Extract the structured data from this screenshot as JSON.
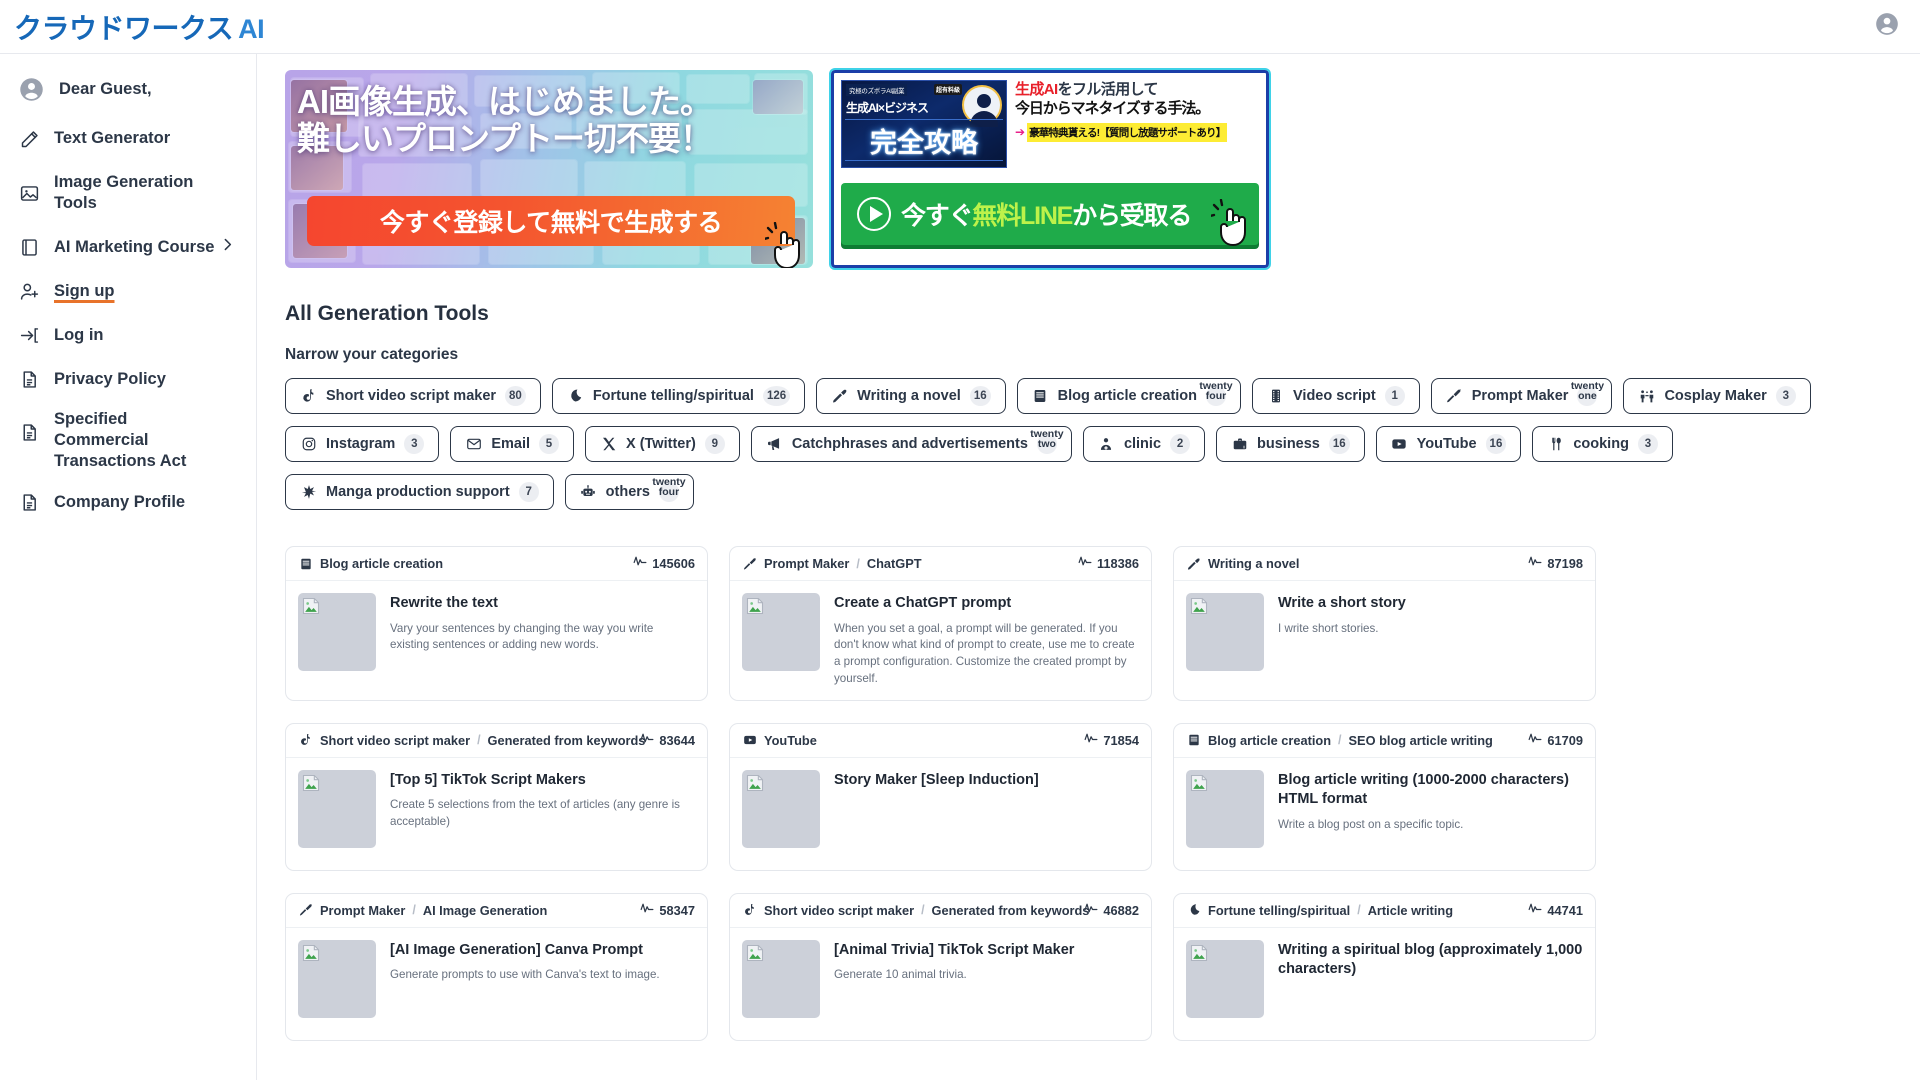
{
  "header": {
    "brand_jp": "クラウドワークス",
    "brand_ai": "AI",
    "account_icon": "account-circle-icon"
  },
  "sidebar": {
    "items": [
      {
        "label": "Dear Guest,",
        "icon": "account-circle-icon",
        "kind": "guest"
      },
      {
        "label": "Text Generator",
        "icon": "pencil-icon",
        "kind": "link"
      },
      {
        "label": "Image Generation Tools",
        "icon": "image-icon",
        "kind": "link"
      },
      {
        "label": "AI Marketing Course",
        "icon": "book-icon",
        "kind": "link",
        "chevron": "chevron-right-icon"
      },
      {
        "label": "Sign up",
        "icon": "user-plus-icon",
        "kind": "signup"
      },
      {
        "label": "Log in",
        "icon": "login-arrow-icon",
        "kind": "link"
      },
      {
        "label": "Privacy Policy",
        "icon": "document-icon",
        "kind": "link"
      },
      {
        "label": "Specified Commercial Transactions Act",
        "icon": "document-icon",
        "kind": "wrap"
      },
      {
        "label": "Company Profile",
        "icon": "document-icon",
        "kind": "link"
      }
    ]
  },
  "banners": [
    {
      "name": "ai-image-generation-banner",
      "line1": "AI画像生成、はじめました。",
      "line2": "難しいプロンプトー切不要！",
      "cta": "今すぐ登録して無料で生成する",
      "cta_color": "#f4542f"
    },
    {
      "name": "ai-marketing-line-banner",
      "thumb_tag": "究極のズボラAI副業",
      "thumb_badge": "超有料級",
      "thumb_line1": "生成AI×ビジネス",
      "thumb_line2": "完全攻略",
      "copy_red": "生成AI",
      "copy_line1_rest": "をフル活用して",
      "copy_line2": "今日からマネタイズする手法。",
      "highlight": "豪華特典貰える!【質問し放題サポートあり】",
      "cta_pre": "今すぐ",
      "cta_lime": "無料LINE",
      "cta_post": "から受取る",
      "cta_color": "#1fab4a",
      "highlight_color": "#fdec34"
    }
  ],
  "main": {
    "title": "All Generation Tools",
    "subtitle": "Narrow your categories"
  },
  "categories": [
    {
      "label": "Short video script maker",
      "count": "80",
      "icon": "tiktok-icon"
    },
    {
      "label": "Fortune telling/spiritual",
      "count": "126",
      "icon": "moon-icon"
    },
    {
      "label": "Writing a novel",
      "count": "16",
      "icon": "fountain-pen-icon"
    },
    {
      "label": "Blog article creation",
      "count": "twenty four",
      "icon": "book-icon",
      "count_word": true
    },
    {
      "label": "Video script",
      "count": "1",
      "icon": "film-strip-icon"
    },
    {
      "label": "Prompt Maker",
      "count": "twenty one",
      "icon": "brush-icon",
      "count_word": true
    },
    {
      "label": "Cosplay Maker",
      "count": "3",
      "icon": "cosplay-icon"
    },
    {
      "label": "Instagram",
      "count": "3",
      "icon": "instagram-icon"
    },
    {
      "label": "Email",
      "count": "5",
      "icon": "envelope-icon"
    },
    {
      "label": "X (Twitter)",
      "count": "9",
      "icon": "x-twitter-icon"
    },
    {
      "label": "Catchphrases and advertisements",
      "count": "twenty two",
      "icon": "megaphone-icon",
      "count_word": true
    },
    {
      "label": "clinic",
      "count": "2",
      "icon": "doctor-icon"
    },
    {
      "label": "business",
      "count": "16",
      "icon": "briefcase-icon"
    },
    {
      "label": "YouTube",
      "count": "16",
      "icon": "youtube-icon"
    },
    {
      "label": "cooking",
      "count": "3",
      "icon": "cutlery-icon"
    },
    {
      "label": "Manga production support",
      "count": "7",
      "icon": "sparkle-icon"
    },
    {
      "label": "others",
      "count": "twenty four",
      "icon": "robot-icon",
      "count_word": true
    }
  ],
  "cards": [
    {
      "category": "Blog article creation",
      "subcategory": "",
      "icon": "book-icon",
      "stat": "145606",
      "stat_icon": "activity-pulse-icon",
      "title": "Rewrite the text",
      "description": "Vary your sentences by changing the way you write existing sentences or adding new words.",
      "thumb_icon": "broken-image-icon"
    },
    {
      "category": "Prompt Maker",
      "subcategory": "ChatGPT",
      "icon": "brush-icon",
      "stat": "118386",
      "stat_icon": "activity-pulse-icon",
      "title": "Create a ChatGPT prompt",
      "description": "When you set a goal, a prompt will be generated. If you don't know what kind of prompt to create, use me to create a prompt configuration. Customize the created prompt by yourself.",
      "thumb_icon": "broken-image-icon"
    },
    {
      "category": "Writing a novel",
      "subcategory": "",
      "icon": "fountain-pen-icon",
      "stat": "87198",
      "stat_icon": "activity-pulse-icon",
      "title": "Write a short story",
      "description": "I write short stories.",
      "thumb_icon": "broken-image-icon"
    },
    {
      "category": "Short video script maker",
      "subcategory": "Generated from keywords",
      "icon": "tiktok-icon",
      "stat": "83644",
      "stat_icon": "activity-pulse-icon",
      "title": "[Top 5] TikTok Script Makers",
      "description": "Create 5 selections from the text of articles (any genre is acceptable)",
      "thumb_icon": "broken-image-icon"
    },
    {
      "category": "YouTube",
      "subcategory": "",
      "icon": "youtube-icon",
      "stat": "71854",
      "stat_icon": "activity-pulse-icon",
      "title": "Story Maker [Sleep Induction]",
      "description": "",
      "thumb_icon": "broken-image-icon"
    },
    {
      "category": "Blog article creation",
      "subcategory": "SEO blog article writing",
      "icon": "book-icon",
      "stat": "61709",
      "stat_icon": "activity-pulse-icon",
      "title": "Blog article writing (1000-2000 characters) HTML format",
      "description": "Write a blog post on a specific topic.",
      "thumb_icon": "broken-image-icon"
    },
    {
      "category": "Prompt Maker",
      "subcategory": "AI Image Generation",
      "icon": "brush-icon",
      "stat": "58347",
      "stat_icon": "activity-pulse-icon",
      "title": "[AI Image Generation] Canva Prompt",
      "description": "Generate prompts to use with Canva's text to image.",
      "thumb_icon": "broken-image-icon"
    },
    {
      "category": "Short video script maker",
      "subcategory": "Generated from keywords",
      "icon": "tiktok-icon",
      "stat": "46882",
      "stat_icon": "activity-pulse-icon",
      "title": "[Animal Trivia] TikTok Script Maker",
      "description": "Generate 10 animal trivia.",
      "thumb_icon": "broken-image-icon"
    },
    {
      "category": "Fortune telling/spiritual",
      "subcategory": "Article writing",
      "icon": "moon-icon",
      "stat": "44741",
      "stat_icon": "activity-pulse-icon",
      "title": "Writing a spiritual blog (approximately 1,000 characters)",
      "description": "",
      "thumb_icon": "broken-image-icon"
    }
  ],
  "colors": {
    "brand": "#1668b8",
    "accent_orange": "#e8732a",
    "text": "#2c3747",
    "muted": "#67707e",
    "chip_border": "#2c3747"
  }
}
